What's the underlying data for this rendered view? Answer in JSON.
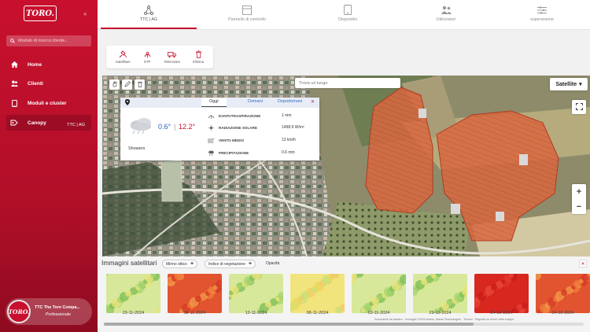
{
  "sidebar": {
    "logo_text": "TORO.",
    "search_placeholder": "Modulo di ricerca cliente...",
    "items": [
      {
        "label": "Home",
        "icon": "home-icon"
      },
      {
        "label": "Clienti",
        "icon": "users-icon"
      },
      {
        "label": "Moduli e cluster",
        "icon": "tablet-icon"
      },
      {
        "label": "Canopy",
        "icon": "canopy-icon",
        "sub": "TTC | AG",
        "active": true
      }
    ],
    "user": {
      "avatar_text": "TORO.",
      "name": "TTC The Toro Compa...",
      "role": "Professionale"
    }
  },
  "topbar": {
    "tabs": [
      {
        "label": "TTC | AG",
        "icon": "network-icon",
        "active": true
      },
      {
        "label": "Pannello di controllo",
        "icon": "dashboard-icon"
      },
      {
        "label": "Dispositivi",
        "icon": "device-icon"
      },
      {
        "label": "Utilizzatori",
        "icon": "user-group-icon"
      },
      {
        "label": "supervisione",
        "icon": "supervision-icon"
      }
    ]
  },
  "toolbar": {
    "tools": [
      {
        "label": "Satellitare",
        "icon": "satellite-icon"
      },
      {
        "label": "ETP",
        "icon": "etp-icon"
      },
      {
        "label": "Rimminare",
        "icon": "truck-icon"
      },
      {
        "label": "Elimina",
        "icon": "trash-icon"
      }
    ]
  },
  "map": {
    "search_placeholder": "Trova un luogo",
    "map_type": "Satellite",
    "zoom_in": "+",
    "zoom_out": "−"
  },
  "weather": {
    "tabs": [
      "Oggi",
      "Domani",
      "Dopodomani"
    ],
    "close": "✕",
    "temp_min": "0.6°",
    "temp_sep": "|",
    "temp_max": "12.2°",
    "condition": "Showers",
    "rows": [
      {
        "label": "EVAPOTRASPIRAZIONE",
        "value": "1 mm",
        "icon": "evapotranspiration-icon"
      },
      {
        "label": "RADIAZIONE SOLARE",
        "value": "1498.9 W/m²",
        "icon": "sun-icon"
      },
      {
        "label": "VENTO MEDIO",
        "value": "13 km/h",
        "icon": "wind-icon"
      },
      {
        "label": "PRECIPITAZIONE",
        "value": "0.6 mm",
        "icon": "rain-icon"
      }
    ]
  },
  "satellite": {
    "title": "Immagini satellitari",
    "filters": [
      {
        "label": "Mirino ottico",
        "plus": "+"
      },
      {
        "label": "Indice di vegetazione",
        "plus": "+"
      }
    ],
    "opacity_label": "Opacità",
    "close": "✕",
    "images": [
      {
        "date": "23-11-2024",
        "tone": "green"
      },
      {
        "date": "18-11-2024",
        "tone": "orange"
      },
      {
        "date": "13-11-2024",
        "tone": "green"
      },
      {
        "date": "08-11-2024",
        "tone": "yellow"
      },
      {
        "date": "03-11-2024",
        "tone": "green"
      },
      {
        "date": "29-10-2024",
        "tone": "green"
      },
      {
        "date": "24-10-2024",
        "tone": "red"
      },
      {
        "date": "04-10-2024",
        "tone": "orange"
      }
    ],
    "attribution": "Scorciatoie da tastiera · Immagini ©2024 Airbus, Maxar Technologies · Termini · Segnala un errore nella mappa"
  },
  "colors": {
    "brand": "#c8102e",
    "link": "#3a6fc4"
  }
}
